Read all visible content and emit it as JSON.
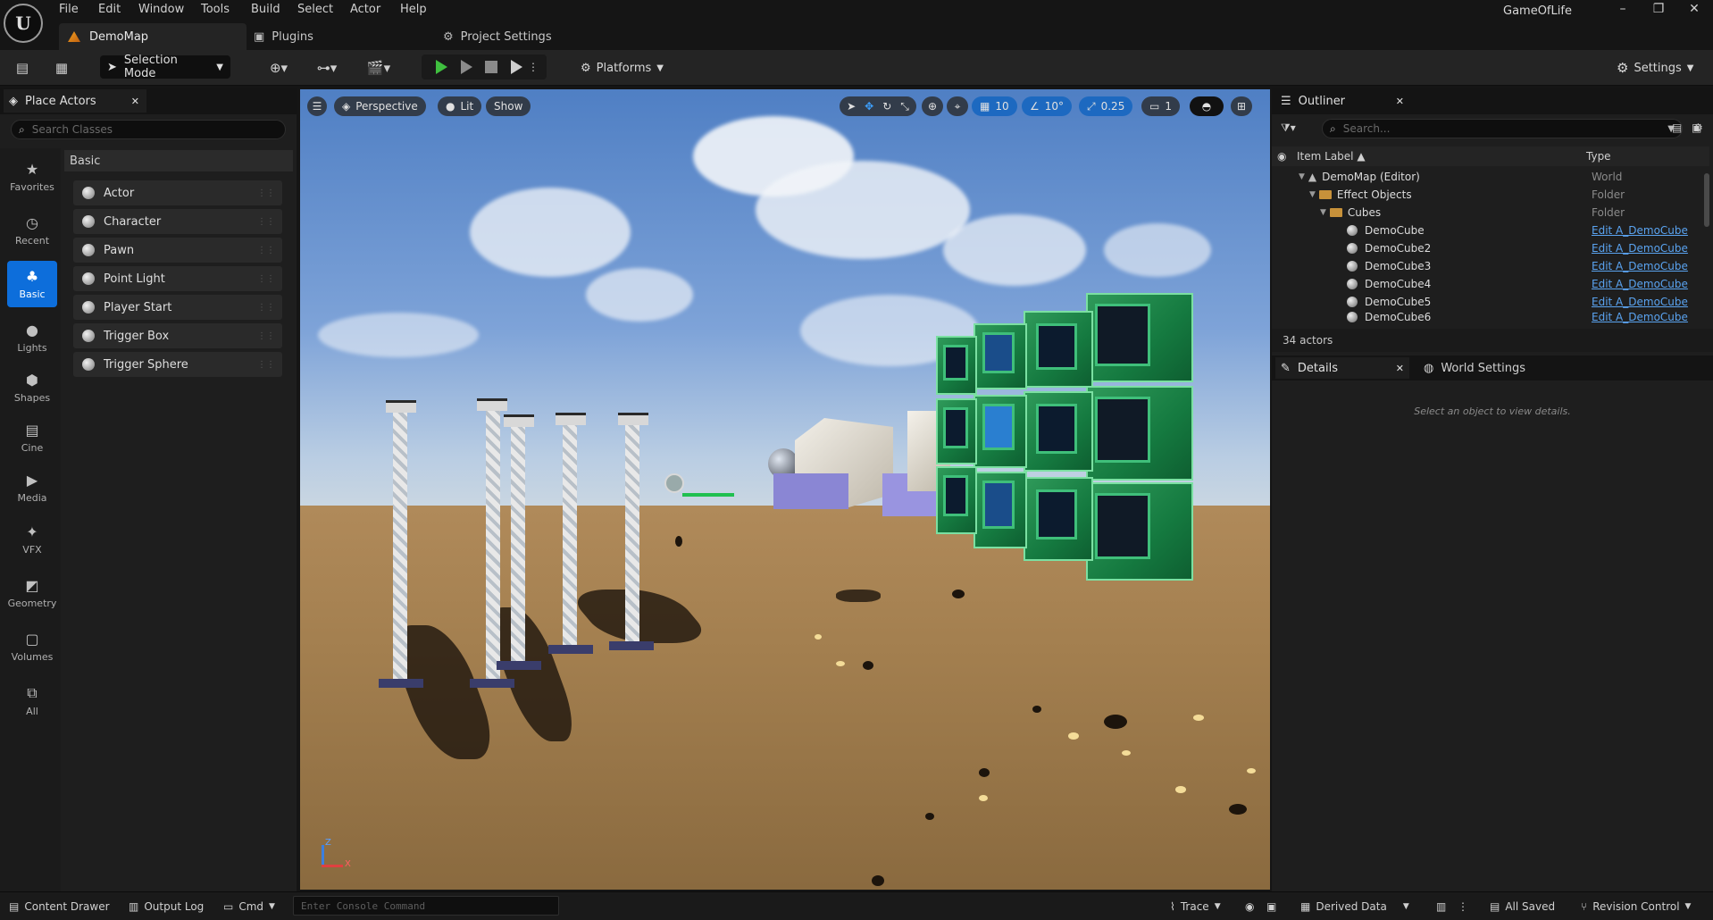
{
  "app": {
    "project_name": "GameOfLife",
    "logo_text": "U"
  },
  "menu": [
    "File",
    "Edit",
    "Window",
    "Tools",
    "Build",
    "Select",
    "Actor",
    "Help"
  ],
  "tabs": {
    "map": "DemoMap",
    "plugins": "Plugins",
    "project_settings": "Project Settings"
  },
  "toolbar": {
    "selection_mode": "Selection Mode",
    "platforms": "Platforms",
    "settings": "Settings"
  },
  "place_actors": {
    "tab_label": "Place Actors",
    "search_placeholder": "Search Classes",
    "section": "Basic",
    "categories": [
      "Favorites",
      "Recent",
      "Basic",
      "Lights",
      "Shapes",
      "Cine",
      "Media",
      "VFX",
      "Geometry",
      "Volumes",
      "All"
    ],
    "active_category": "Basic",
    "items": [
      "Actor",
      "Character",
      "Pawn",
      "Point Light",
      "Player Start",
      "Trigger Box",
      "Trigger Sphere"
    ]
  },
  "viewport": {
    "perspective": "Perspective",
    "lit": "Lit",
    "show": "Show",
    "grid_snap": "10",
    "rotation_snap": "10°",
    "scale_snap": "0.25",
    "camera_speed": "1",
    "axis": {
      "z": "Z",
      "x": "X"
    }
  },
  "outliner": {
    "tab_label": "Outliner",
    "search_placeholder": "Search...",
    "col_label": "Item Label ▲",
    "col_type": "Type",
    "rows": [
      {
        "label": "DemoMap (Editor)",
        "type": "World"
      },
      {
        "label": "Effect Objects",
        "type": "Folder"
      },
      {
        "label": "Cubes",
        "type": "Folder"
      },
      {
        "label": "DemoCube",
        "type": "Edit A_DemoCube"
      },
      {
        "label": "DemoCube2",
        "type": "Edit A_DemoCube"
      },
      {
        "label": "DemoCube3",
        "type": "Edit A_DemoCube"
      },
      {
        "label": "DemoCube4",
        "type": "Edit A_DemoCube"
      },
      {
        "label": "DemoCube5",
        "type": "Edit A_DemoCube"
      },
      {
        "label": "DemoCube6",
        "type": "Edit A_DemoCube"
      }
    ],
    "count": "34 actors"
  },
  "details": {
    "tab_label": "Details",
    "world_settings": "World Settings",
    "empty_message": "Select an object to view details."
  },
  "bottom": {
    "content_drawer": "Content Drawer",
    "output_log": "Output Log",
    "cmd": "Cmd",
    "console_placeholder": "Enter Console Command",
    "trace": "Trace",
    "derived_data": "Derived Data",
    "all_saved": "All Saved",
    "revision_control": "Revision Control"
  }
}
